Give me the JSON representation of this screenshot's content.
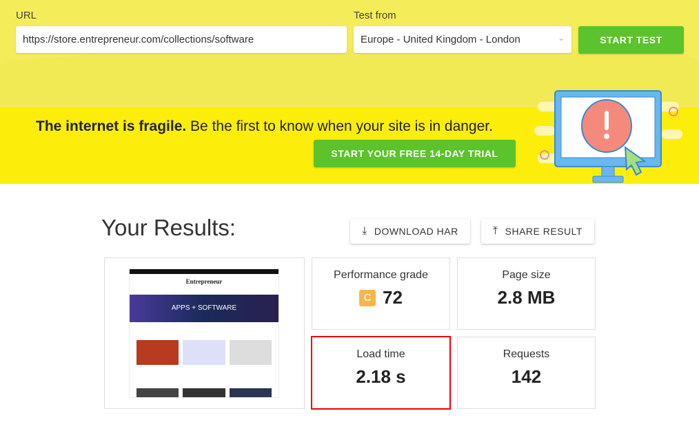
{
  "form": {
    "url_label": "URL",
    "url_value": "https://store.entrepreneur.com/collections/software",
    "test_from_label": "Test from",
    "test_from_value": "Europe - United Kingdom - London",
    "start_test": "START TEST"
  },
  "banner": {
    "bold": "The internet is fragile.",
    "text": " Be the first to know when your site is in danger.",
    "cta": "START YOUR FREE 14-DAY TRIAL"
  },
  "results": {
    "title": "Your Results:",
    "download_har": "DOWNLOAD HAR",
    "share_result": "SHARE RESULT",
    "thumbnail": {
      "logo": "Entrepreneur",
      "hero": "APPS + SOFTWARE"
    },
    "metrics": [
      {
        "label": "Performance grade",
        "grade": "C",
        "value": "72"
      },
      {
        "label": "Page size",
        "value": "2.8 MB"
      },
      {
        "label": "Load time",
        "value": "2.18 s"
      },
      {
        "label": "Requests",
        "value": "142"
      }
    ]
  },
  "colors": {
    "green": "#5cc32c",
    "yellow": "#fcee0a",
    "grade_c": "#f6b64b",
    "highlight": "#e00000"
  }
}
